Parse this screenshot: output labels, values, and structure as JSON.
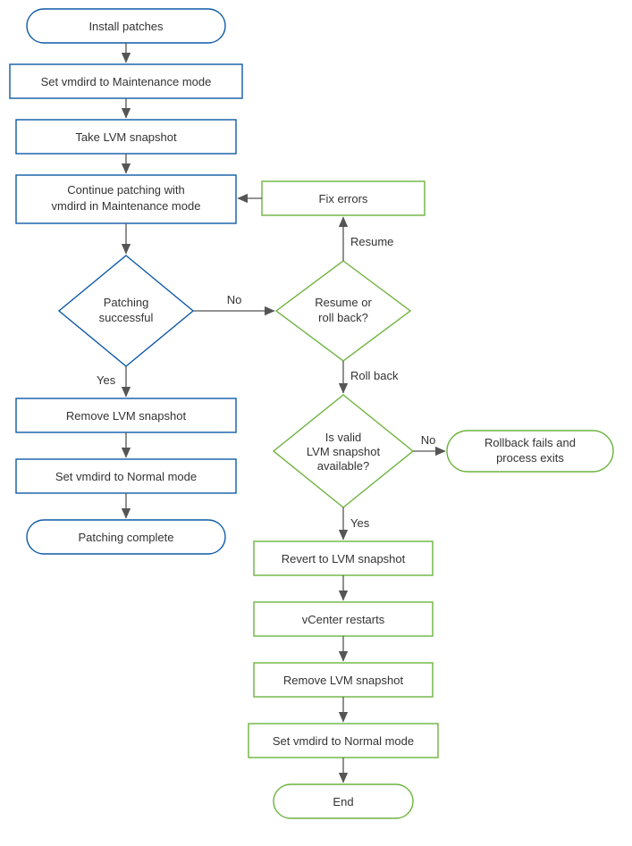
{
  "nodes": {
    "install": "Install patches",
    "maint": "Set vmdird to Maintenance mode",
    "take": "Take LVM snapshot",
    "cont1": "Continue patching with",
    "cont2": "vmdird in Maintenance mode",
    "pat1": "Patching",
    "pat2": "successful",
    "res1": "Resume or",
    "res2": "roll back?",
    "fix": "Fix errors",
    "valid1": "Is valid",
    "valid2": "LVM snapshot",
    "valid3": "available?",
    "fail1": "Rollback fails and",
    "fail2": "process exits",
    "remove1": "Remove LVM snapshot",
    "normal1": "Set vmdird to Normal mode",
    "done": "Patching complete",
    "revert": "Revert to LVM snapshot",
    "restart": "vCenter restarts",
    "remove2": "Remove LVM snapshot",
    "normal2": "Set vmdird to Normal mode",
    "end": "End"
  },
  "edge_labels": {
    "yes1": "Yes",
    "no1": "No",
    "resume": "Resume",
    "rollback": "Roll back",
    "yes2": "Yes",
    "no2": "No"
  },
  "colors": {
    "blue": "#0d5aa7",
    "green": "#6db33f",
    "arrow": "#555555"
  },
  "chart_data": {
    "type": "flowchart",
    "nodes": [
      {
        "id": "install",
        "label": "Install patches",
        "kind": "terminal",
        "color": "blue"
      },
      {
        "id": "maint",
        "label": "Set vmdird to Maintenance mode",
        "kind": "process",
        "color": "blue"
      },
      {
        "id": "take",
        "label": "Take LVM snapshot",
        "kind": "process",
        "color": "blue"
      },
      {
        "id": "cont",
        "label": "Continue patching with vmdird in Maintenance mode",
        "kind": "process",
        "color": "blue"
      },
      {
        "id": "pat",
        "label": "Patching successful",
        "kind": "decision",
        "color": "blue"
      },
      {
        "id": "res",
        "label": "Resume or roll back?",
        "kind": "decision",
        "color": "green"
      },
      {
        "id": "fix",
        "label": "Fix errors",
        "kind": "process",
        "color": "green"
      },
      {
        "id": "valid",
        "label": "Is valid LVM snapshot available?",
        "kind": "decision",
        "color": "green"
      },
      {
        "id": "fail",
        "label": "Rollback fails and process exits",
        "kind": "terminal",
        "color": "green"
      },
      {
        "id": "remove1",
        "label": "Remove LVM snapshot",
        "kind": "process",
        "color": "blue"
      },
      {
        "id": "normal1",
        "label": "Set vmdird to Normal mode",
        "kind": "process",
        "color": "blue"
      },
      {
        "id": "done",
        "label": "Patching complete",
        "kind": "terminal",
        "color": "blue"
      },
      {
        "id": "revert",
        "label": "Revert to LVM snapshot",
        "kind": "process",
        "color": "green"
      },
      {
        "id": "restart",
        "label": "vCenter restarts",
        "kind": "process",
        "color": "green"
      },
      {
        "id": "remove2",
        "label": "Remove LVM snapshot",
        "kind": "process",
        "color": "green"
      },
      {
        "id": "normal2",
        "label": "Set vmdird to Normal mode",
        "kind": "process",
        "color": "green"
      },
      {
        "id": "end",
        "label": "End",
        "kind": "terminal",
        "color": "green"
      }
    ],
    "edges": [
      {
        "from": "install",
        "to": "maint"
      },
      {
        "from": "maint",
        "to": "take"
      },
      {
        "from": "take",
        "to": "cont"
      },
      {
        "from": "cont",
        "to": "pat"
      },
      {
        "from": "pat",
        "to": "remove1",
        "label": "Yes"
      },
      {
        "from": "pat",
        "to": "res",
        "label": "No"
      },
      {
        "from": "res",
        "to": "fix",
        "label": "Resume"
      },
      {
        "from": "fix",
        "to": "cont"
      },
      {
        "from": "res",
        "to": "valid",
        "label": "Roll back"
      },
      {
        "from": "valid",
        "to": "revert",
        "label": "Yes"
      },
      {
        "from": "valid",
        "to": "fail",
        "label": "No"
      },
      {
        "from": "remove1",
        "to": "normal1"
      },
      {
        "from": "normal1",
        "to": "done"
      },
      {
        "from": "revert",
        "to": "restart"
      },
      {
        "from": "restart",
        "to": "remove2"
      },
      {
        "from": "remove2",
        "to": "normal2"
      },
      {
        "from": "normal2",
        "to": "end"
      }
    ]
  }
}
